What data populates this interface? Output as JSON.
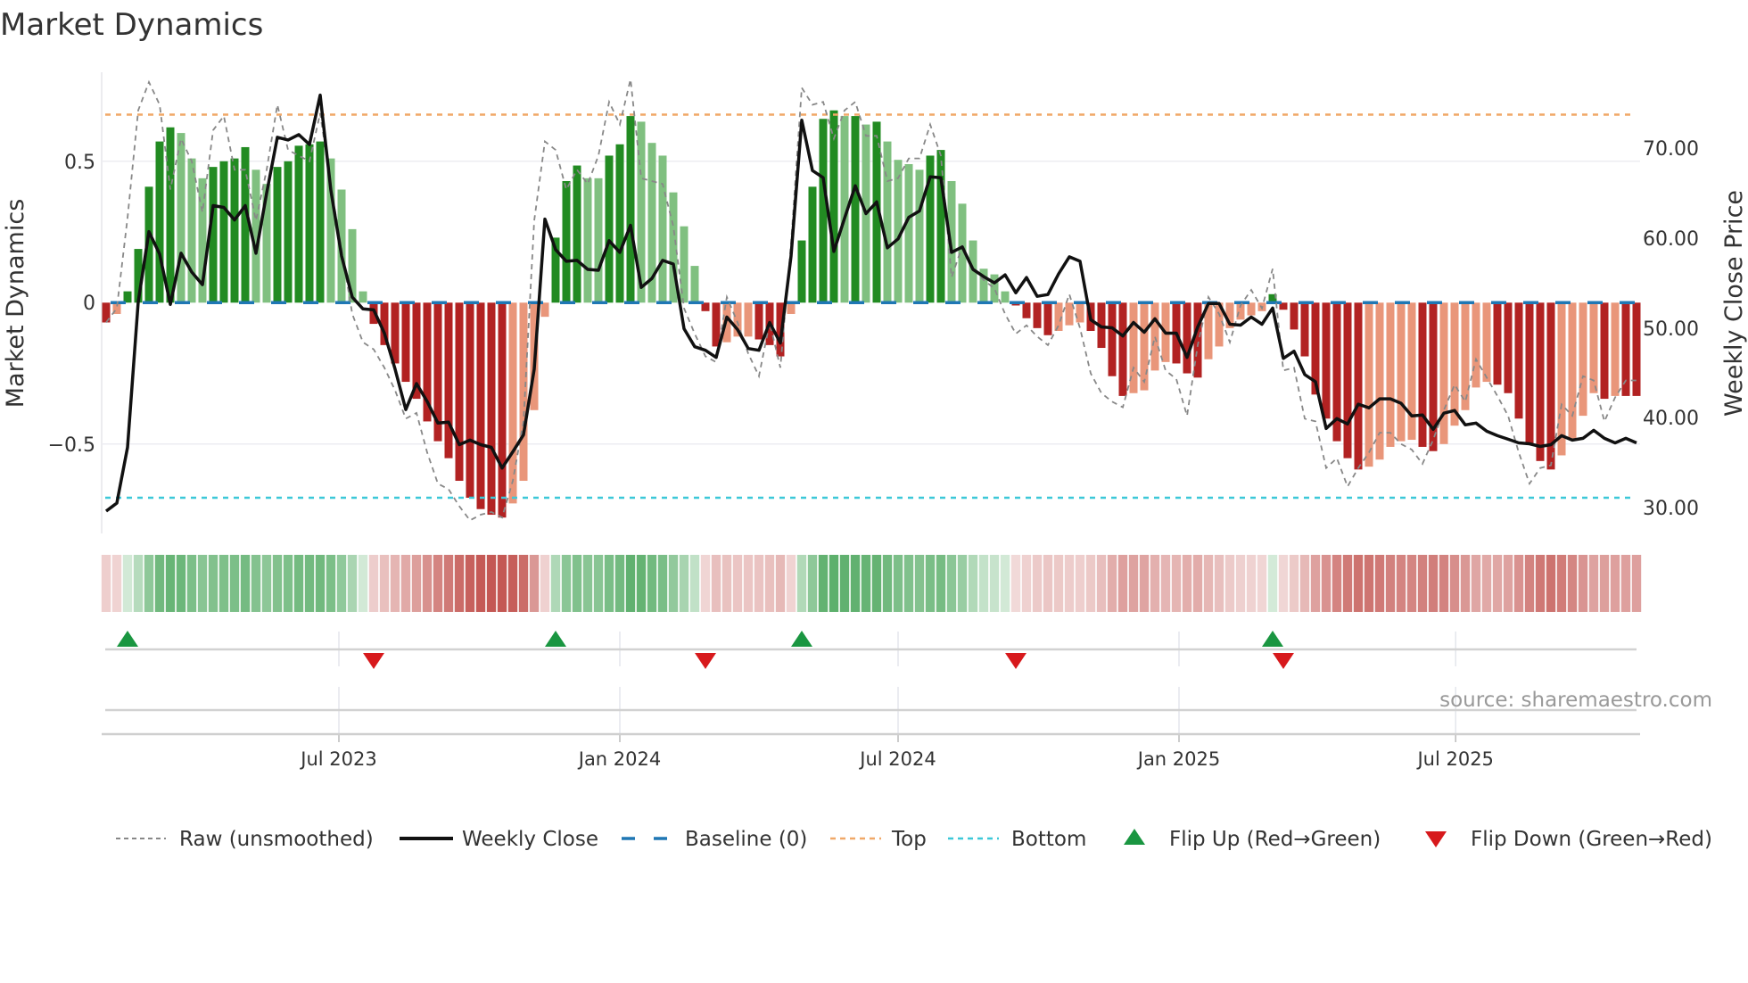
{
  "title": "Market Dynamics",
  "source": "source: sharemaestro.com",
  "colors": {
    "strong_green": "#228b22",
    "weak_green": "#80c080",
    "strong_red": "#b22222",
    "weak_red": "#e9967a",
    "raw": "#888888",
    "close": "#111111",
    "baseline": "#1f77b4",
    "top": "#f0a868",
    "bottom": "#3cc8d8",
    "flip_up": "#1a9641",
    "flip_down": "#d7191c"
  },
  "chart_data": {
    "type": "bar",
    "title": "Market Dynamics",
    "ylabel": "Market Dynamics",
    "y2label": "Weekly Close Price",
    "ylim": [
      -0.82,
      0.82
    ],
    "y2lim": [
      26.5,
      77.8
    ],
    "yticks": [
      "0.5",
      "0",
      "−0.5"
    ],
    "ytick_values": [
      0.5,
      0,
      -0.5
    ],
    "y2ticks": [
      "70.00",
      "60.00",
      "50.00",
      "40.00",
      "30.00"
    ],
    "y2tick_values": [
      70,
      60,
      50,
      40,
      30
    ],
    "x_unit": "week index",
    "xticks": [
      "Jul 2023",
      "Jan 2024",
      "Jul 2024",
      "Jan 2025",
      "Jul 2025"
    ],
    "xtick_positions": [
      22.75,
      49.0,
      75.0,
      101.25,
      127.1
    ],
    "top_level": 0.665,
    "bottom_level": -0.69,
    "baseline": 0,
    "state_codes": {
      "G": "strong green",
      "g": "weak green",
      "R": "strong red",
      "r": "weak red"
    },
    "values": [
      -0.07,
      -0.04,
      0.04,
      0.19,
      0.41,
      0.57,
      0.62,
      0.6,
      0.51,
      0.44,
      0.48,
      0.5,
      0.51,
      0.55,
      0.47,
      0.42,
      0.48,
      0.5,
      0.555,
      0.56,
      0.57,
      0.51,
      0.4,
      0.26,
      0.04,
      -0.075,
      -0.15,
      -0.215,
      -0.28,
      -0.34,
      -0.42,
      -0.49,
      -0.55,
      -0.63,
      -0.69,
      -0.73,
      -0.75,
      -0.76,
      -0.71,
      -0.63,
      -0.38,
      -0.05,
      0.23,
      0.43,
      0.485,
      0.44,
      0.44,
      0.52,
      0.56,
      0.66,
      0.64,
      0.565,
      0.52,
      0.39,
      0.27,
      0.13,
      -0.03,
      -0.155,
      -0.14,
      -0.12,
      -0.12,
      -0.13,
      -0.15,
      -0.19,
      -0.04,
      0.22,
      0.41,
      0.65,
      0.68,
      0.66,
      0.66,
      0.63,
      0.64,
      0.57,
      0.505,
      0.49,
      0.47,
      0.52,
      0.54,
      0.43,
      0.35,
      0.22,
      0.12,
      0.1,
      0.04,
      -0.01,
      -0.055,
      -0.09,
      -0.115,
      -0.1,
      -0.08,
      -0.07,
      -0.1,
      -0.16,
      -0.26,
      -0.33,
      -0.32,
      -0.31,
      -0.24,
      -0.21,
      -0.215,
      -0.25,
      -0.265,
      -0.2,
      -0.155,
      -0.09,
      -0.06,
      -0.045,
      -0.03,
      0.03,
      -0.025,
      -0.095,
      -0.19,
      -0.325,
      -0.41,
      -0.49,
      -0.55,
      -0.59,
      -0.58,
      -0.555,
      -0.51,
      -0.49,
      -0.485,
      -0.51,
      -0.525,
      -0.5,
      -0.435,
      -0.38,
      -0.3,
      -0.28,
      -0.29,
      -0.32,
      -0.41,
      -0.5,
      -0.56,
      -0.59,
      -0.54,
      -0.48,
      -0.4,
      -0.32,
      -0.34,
      -0.33,
      -0.33,
      -0.33
    ],
    "states": "RrGGGGGgggGGGGggGGGGGggggRRRRRRRRRRRRRrrrrGGGggGGGggggggRRrrrRRRrGGGGgGgGggggGGggggggRRRRrrrRRRRrrrrRRRrrrrrrGRRRRRRRRrrrrrRRrrrrrRRRRRRrrrrRrRR",
    "raw": [
      -0.07,
      -0.02,
      0.3,
      0.68,
      0.78,
      0.7,
      0.4,
      0.58,
      0.5,
      0.32,
      0.61,
      0.66,
      0.47,
      0.47,
      0.29,
      0.47,
      0.7,
      0.54,
      0.52,
      0.5,
      0.67,
      0.41,
      0.19,
      -0.04,
      -0.14,
      -0.165,
      -0.23,
      -0.31,
      -0.41,
      -0.39,
      -0.53,
      -0.64,
      -0.66,
      -0.72,
      -0.77,
      -0.75,
      -0.74,
      -0.76,
      -0.63,
      -0.42,
      0.29,
      0.57,
      0.54,
      0.4,
      0.47,
      0.42,
      0.52,
      0.71,
      0.63,
      0.79,
      0.44,
      0.43,
      0.42,
      0.27,
      -0.02,
      -0.11,
      -0.19,
      -0.21,
      0.02,
      -0.07,
      -0.18,
      -0.26,
      -0.07,
      -0.23,
      0.21,
      0.76,
      0.7,
      0.71,
      0.58,
      0.68,
      0.71,
      0.59,
      0.59,
      0.43,
      0.44,
      0.51,
      0.51,
      0.63,
      0.52,
      0.09,
      0.2,
      0.12,
      0.08,
      0.05,
      -0.04,
      -0.11,
      -0.08,
      -0.12,
      -0.15,
      -0.08,
      0.03,
      -0.09,
      -0.25,
      -0.32,
      -0.35,
      -0.37,
      -0.23,
      -0.28,
      -0.12,
      -0.24,
      -0.27,
      -0.4,
      -0.15,
      0.02,
      -0.04,
      -0.14,
      -0.01,
      0.045,
      -0.02,
      0.12,
      -0.24,
      -0.23,
      -0.41,
      -0.42,
      -0.585,
      -0.55,
      -0.65,
      -0.585,
      -0.53,
      -0.46,
      -0.46,
      -0.5,
      -0.52,
      -0.57,
      -0.485,
      -0.38,
      -0.29,
      -0.35,
      -0.2,
      -0.265,
      -0.33,
      -0.4,
      -0.53,
      -0.64,
      -0.585,
      -0.575,
      -0.36,
      -0.4,
      -0.26,
      -0.275,
      -0.42,
      -0.335,
      -0.275,
      -0.275
    ],
    "weekly_close": [
      29.6,
      30.5,
      36.7,
      52.9,
      60.7,
      58.2,
      52.6,
      58.3,
      56.2,
      54.8,
      63.6,
      63.4,
      62.0,
      63.6,
      58.3,
      65.0,
      71.2,
      70.9,
      71.5,
      70.4,
      75.9,
      65.3,
      58.0,
      53.4,
      52.1,
      52.0,
      49.4,
      45.4,
      40.9,
      43.8,
      41.8,
      39.4,
      39.5,
      37.0,
      37.5,
      37.0,
      36.7,
      34.4,
      36.2,
      38.1,
      45.4,
      62.1,
      58.7,
      57.4,
      57.5,
      56.5,
      56.4,
      59.7,
      58.4,
      61.4,
      54.5,
      55.5,
      57.5,
      57.1,
      49.9,
      47.9,
      47.5,
      46.7,
      51.2,
      49.8,
      47.7,
      47.5,
      50.6,
      48.3,
      58.0,
      73.1,
      67.5,
      66.7,
      58.5,
      62.2,
      65.8,
      62.7,
      64.0,
      58.9,
      59.9,
      62.3,
      63.0,
      66.8,
      66.7,
      58.4,
      59.0,
      56.5,
      55.7,
      55.0,
      55.9,
      53.9,
      55.6,
      53.5,
      53.7,
      56.0,
      57.9,
      57.4,
      50.9,
      50.1,
      50.0,
      49.1,
      50.6,
      49.5,
      51.0,
      49.4,
      49.4,
      46.7,
      50.1,
      52.7,
      52.7,
      50.4,
      50.3,
      51.2,
      50.4,
      52.2,
      46.6,
      47.4,
      44.8,
      44.0,
      38.8,
      39.9,
      39.3,
      41.5,
      41.1,
      42.1,
      42.1,
      41.6,
      40.2,
      40.3,
      38.7,
      40.5,
      40.8,
      39.2,
      39.4,
      38.5,
      38.0,
      37.6,
      37.2,
      37.1,
      36.8,
      37.0,
      38.0,
      37.5,
      37.7,
      38.6,
      37.7,
      37.2,
      37.7,
      37.2
    ],
    "flip_up_weeks": [
      3,
      43,
      66,
      110
    ],
    "flip_down_weeks": [
      26,
      57,
      86,
      111
    ],
    "legend_position": "bottom",
    "legend": [
      {
        "key": "raw",
        "label": "Raw (unsmoothed)"
      },
      {
        "key": "close",
        "label": "Weekly Close"
      },
      {
        "key": "baseline",
        "label": "Baseline (0)"
      },
      {
        "key": "top",
        "label": "Top"
      },
      {
        "key": "bottom",
        "label": "Bottom"
      },
      {
        "key": "flip_up",
        "label": "Flip Up (Red→Green)"
      },
      {
        "key": "flip_down",
        "label": "Flip Down (Green→Red)"
      }
    ]
  }
}
